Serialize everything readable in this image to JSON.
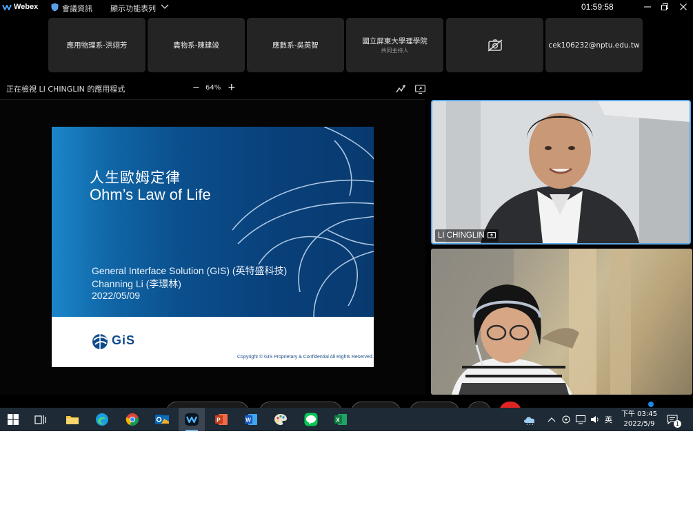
{
  "titlebar": {
    "app_name": "Webex",
    "meeting_info": "會議資訊",
    "show_menu": "顯示功能表列",
    "elapsed": "01:59:58"
  },
  "participants": [
    {
      "name": "應用物理系-洪翊芳",
      "sub": ""
    },
    {
      "name": "農物系-陳建竣",
      "sub": ""
    },
    {
      "name": "應數系-吳英智",
      "sub": ""
    },
    {
      "name": "國立屏東大學理學院",
      "sub": "共同主持人"
    },
    {
      "name": "",
      "sub": ""
    },
    {
      "name": "cek106232@nptu.edu.tw",
      "sub": ""
    }
  ],
  "share": {
    "viewing_label": "正在檢視 LI CHINGLIN 的應用程式",
    "zoom_minus": "−",
    "zoom_level": "64%",
    "zoom_plus": "+"
  },
  "slide": {
    "title_zh": "人生歐姆定律",
    "title_en": "Ohm’s Law of Life",
    "line1": "General Interface Solution (GIS) (英特盛科技)",
    "line2": "Channing Li (李璟林)",
    "line3": "2022/05/09",
    "logo_text": "GiS",
    "copyright": "Copyright © GIS  Proprietary & Confidential  All Rights Reserved."
  },
  "videos": {
    "speaker_name": "LI CHINGLIN"
  },
  "tray": {
    "ime": "英",
    "clock_line1": "下午 03:45",
    "clock_line2": "2022/5/9",
    "notifications": "1"
  },
  "colors": {
    "accent": "#5ba7e6",
    "end_call": "#e02424",
    "taskbar": "#1e2a35"
  }
}
